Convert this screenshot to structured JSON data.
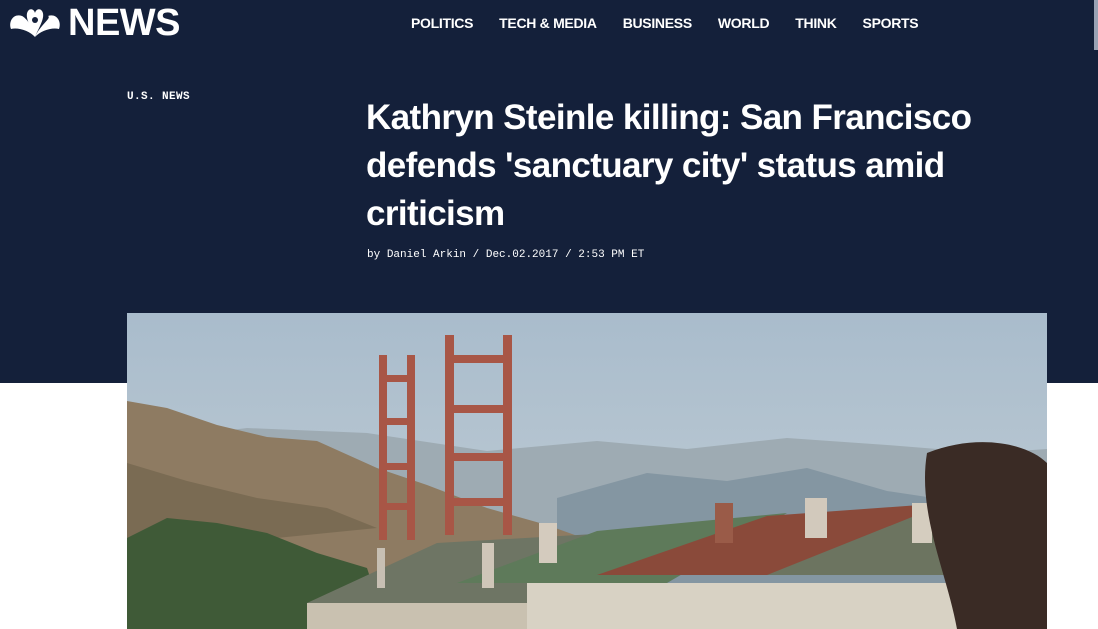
{
  "header": {
    "logo_text": "NEWS",
    "logo_icon": "peacock-icon",
    "nav": [
      "POLITICS",
      "TECH & MEDIA",
      "BUSINESS",
      "WORLD",
      "THINK",
      "SPORTS"
    ]
  },
  "article": {
    "section": "U.S. NEWS",
    "headline": "Kathryn Steinle killing: San Francisco defends 'sanctuary city' status amid criticism",
    "byline_prefix": "by ",
    "author": "Daniel Arkin",
    "separator": " / ",
    "date": "Dec.02.2017",
    "time": "2:53 PM ET"
  },
  "colors": {
    "brand_navy": "#14203a",
    "text": "#ffffff"
  }
}
